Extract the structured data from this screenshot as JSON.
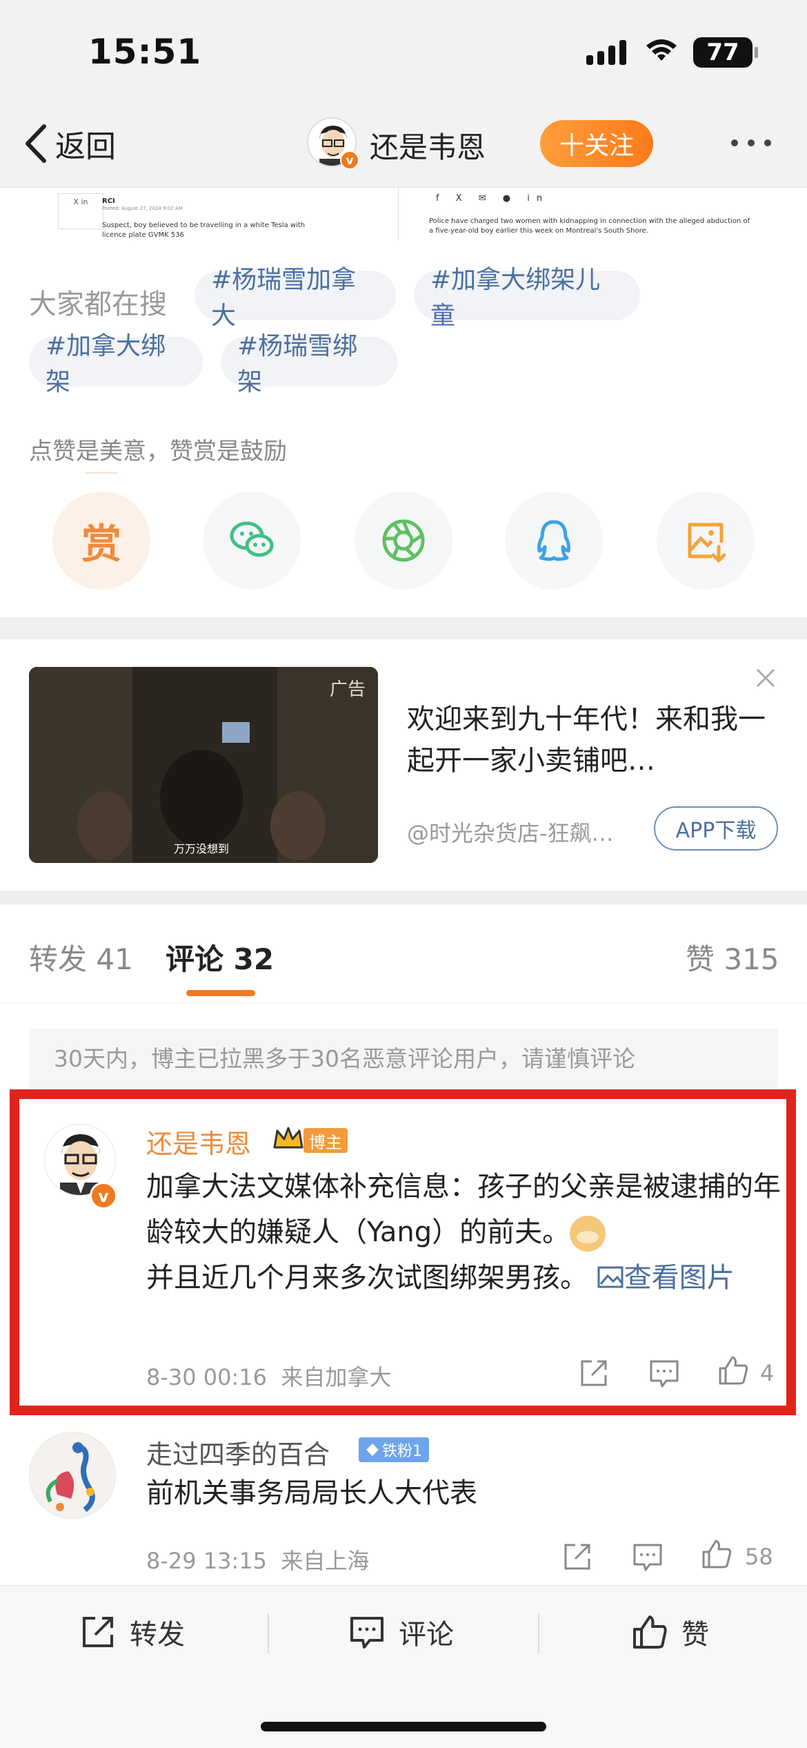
{
  "status_bar": {
    "time": "15:51",
    "battery": "77"
  },
  "nav": {
    "back_label": "返回",
    "user_name": "还是韦恩",
    "verified_mark": "v",
    "follow_label": "十关注"
  },
  "article_snippet": {
    "left_source": "RCI",
    "left_date": "Posted: August 27, 2024 9:02 AM",
    "left_caption": "Suspect, boy believed to be travelling in a white Tesla with licence plate GVMK 536",
    "left_icons": "X in",
    "right_share": "f X ✉ ● in",
    "right_caption": "Police have charged two women with kidnapping in connection with the alleged abduction of a five-year-old boy earlier this week on Montreal's South Shore."
  },
  "search": {
    "label": "大家都在搜",
    "tags": [
      "#杨瑞雪加拿大",
      "#加拿大绑架儿童",
      "#加拿大绑架",
      "#杨瑞雪绑架"
    ]
  },
  "reward": {
    "label": "点赞是美意，赞赏是鼓励",
    "reward_char": "赏"
  },
  "share_icons": [
    "wechat-icon",
    "moments-icon",
    "qq-icon",
    "save-image-icon"
  ],
  "ad": {
    "tag": "广告",
    "image_caption": "万万没想到",
    "title": "欢迎来到九十年代！来和我一起开一家小卖铺吧…",
    "source": "@时光杂货店-狂飙…",
    "button": "APP下载"
  },
  "tabs": [
    {
      "label": "转发 41"
    },
    {
      "label": "评论 32"
    },
    {
      "label": "赞 315"
    }
  ],
  "notice": "30天内，博主已拉黑多于30名恶意评论用户，请谨慎评论",
  "comments": [
    {
      "user": "还是韦恩",
      "badge": "博主",
      "text_before_emoji": "加拿大法文媒体补充信息：孩子的父亲是被逮捕的年龄较大的嫌疑人（Yang）的前夫。",
      "text_after_emoji": "并且近几个月来多次试图绑架男孩。",
      "image_link": "查看图片",
      "time": "8-30 00:16",
      "location": "来自加拿大",
      "likes": "4"
    },
    {
      "user": "走过四季的百合",
      "badge": "铁粉1",
      "text": "前机关事务局局长人大代表",
      "time": "8-29 13:15",
      "location": "来自上海",
      "likes": "58"
    }
  ],
  "bottom_bar": {
    "repost": "转发",
    "comment": "评论",
    "like": "赞"
  },
  "colors": {
    "accent": "#f07a1e",
    "link": "#4b6fa1",
    "highlight_border": "#e0241c"
  }
}
